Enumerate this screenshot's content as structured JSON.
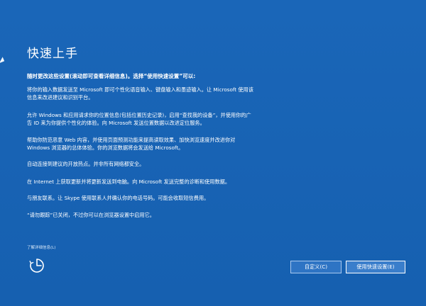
{
  "page": {
    "title": "快速上手",
    "subtitle": "随时更改这些设置(滚动即可查看详细信息)。选择“使用快速设置”可以:",
    "paragraphs": [
      "将你的输入数据发送至 Microsoft 即可个性化语音输入、键盘输入和墨迹输入。让 Microsoft 使用该\n信息来改进建议和识别平台。",
      "允许 Windows 和应用请求你的位置信息(包括位置历史记录)，启用“查找我的设备”，并使用你的广\n告 ID 来为你提供个性化的体验。向 Microsoft 发送位置数据以改进定位服务。",
      "帮助你防范恶意 Web 内容，并使用页面预测功能来提高读取效果、加快浏览速度并改进你对\nWindows 浏览器的总体体验。你的浏览数据将会发送给 Microsoft。",
      "自动连接到建议的开放热点。并非所有网络都安全。",
      "在 Internet 上获取更新并将更新发送到电脑。向 Microsoft 发送完整的诊断和使用数据。",
      "与朋友联系。让 Skype 使用联系人并确认你的电话号码。可能会收取短信费用。",
      "“请勿跟踪”已关闭，不过你可以在浏览器设置中启用它。"
    ],
    "learn_more": "了解详细信息(L)",
    "buttons": {
      "customize": "自定义(C)",
      "express": "使用快速设置(E)"
    }
  },
  "icons": {
    "ease_of_access": "ease-of-access-icon",
    "cursor": "mouse-cursor-icon"
  },
  "colors": {
    "background": "#1763b4",
    "button": "#2e74c4",
    "text": "#ffffff"
  }
}
